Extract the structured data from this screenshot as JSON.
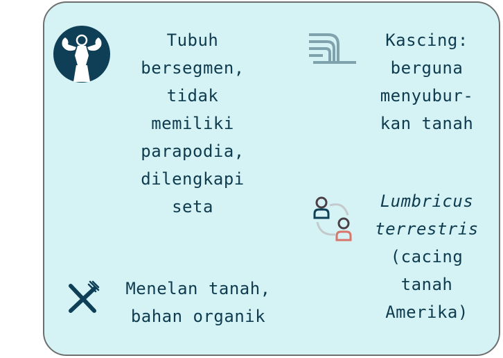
{
  "items": [
    {
      "icon": "muscle-person-icon",
      "lines": [
        "Tubuh",
        "bersegmen,",
        "tidak",
        "memiliki",
        "parapodia,",
        "dilengkapi",
        "seta"
      ]
    },
    {
      "icon": "compost-wave-icon",
      "lines": [
        "Kascing:",
        "berguna",
        "menyubur-",
        "kan tanah"
      ]
    },
    {
      "icon": "exchange-people-icon",
      "italic_lines": [
        "Lumbricus",
        "terrestris"
      ],
      "lines": [
        "(cacing",
        "tanah",
        "Amerika)"
      ]
    },
    {
      "icon": "fork-knife-icon",
      "lines": [
        "Menelan tanah,",
        "bahan organik"
      ]
    }
  ]
}
